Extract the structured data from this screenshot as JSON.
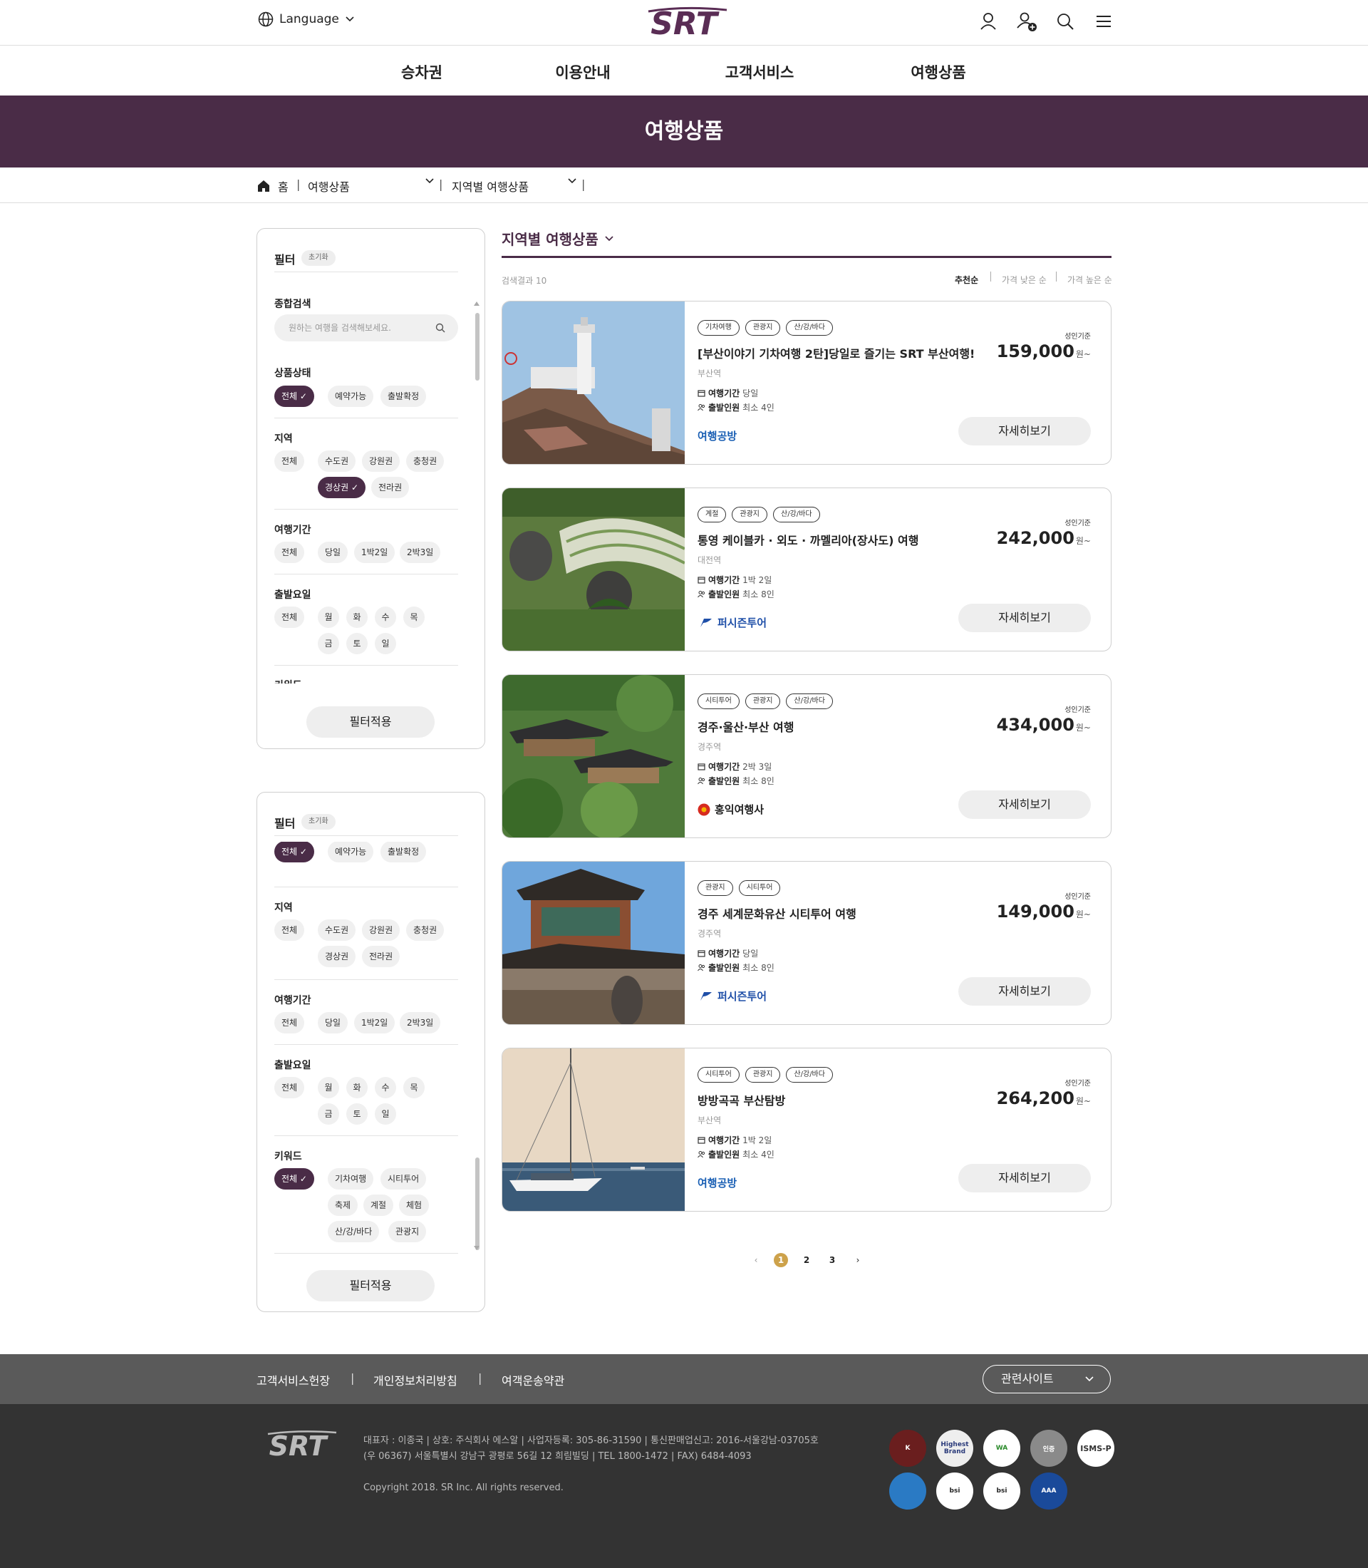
{
  "header": {
    "language_label": "Language",
    "logo_text": "SRT",
    "icons": [
      "user-icon",
      "user-add-icon",
      "search-icon",
      "menu-icon"
    ]
  },
  "gnb": [
    "승차권",
    "이용안내",
    "고객서비스",
    "여행상품"
  ],
  "banner": {
    "title": "여행상품"
  },
  "breadcrumb": {
    "home": "홈",
    "level1": "여행상품",
    "level2": "지역별 여행상품"
  },
  "filter_panels": [
    {
      "title": "필터",
      "reset": "초기화",
      "search": {
        "title": "종합검색",
        "placeholder": "원하는 여행을 검색해보세요."
      },
      "status": {
        "title": "상품상태",
        "options": [
          "전체",
          "예약가능",
          "출발확정"
        ],
        "selected": "전체"
      },
      "region": {
        "title": "지역",
        "options": [
          "전체",
          "수도권",
          "강원권",
          "충청권",
          "경상권",
          "전라권"
        ],
        "selected": "경상권"
      },
      "duration": {
        "title": "여행기간",
        "options": [
          "전체",
          "당일",
          "1박2일",
          "2박3일"
        ]
      },
      "day": {
        "title": "출발요일",
        "options": [
          "전체",
          "월",
          "화",
          "수",
          "목",
          "금",
          "토",
          "일"
        ]
      },
      "keyword_partial": "키워드",
      "apply": "필터적용"
    },
    {
      "title": "필터",
      "reset": "초기화",
      "status": {
        "options": [
          "전체",
          "예약가능",
          "출발확정"
        ],
        "selected": "전체"
      },
      "region": {
        "title": "지역",
        "options": [
          "전체",
          "수도권",
          "강원권",
          "충청권",
          "경상권",
          "전라권"
        ]
      },
      "duration": {
        "title": "여행기간",
        "options": [
          "전체",
          "당일",
          "1박2일",
          "2박3일"
        ]
      },
      "day": {
        "title": "출발요일",
        "options": [
          "전체",
          "월",
          "화",
          "수",
          "목",
          "금",
          "토",
          "일"
        ]
      },
      "keyword": {
        "title": "키워드",
        "options": [
          "전체",
          "기차여행",
          "시티투어",
          "축제",
          "계절",
          "체험",
          "산/강/바다",
          "관광지"
        ],
        "selected": "전체"
      },
      "apply": "필터적용"
    }
  ],
  "listing": {
    "title": "지역별 여행상품",
    "count_text": "검색결과 10",
    "sort": [
      "추천순",
      "가격 낮은 순",
      "가격 높은 순"
    ],
    "sort_selected": "추천순",
    "labels": {
      "duration": "여행기간",
      "people": "출발인원",
      "price_basis": "성인기준",
      "unit": "원~",
      "detail": "자세히보기"
    },
    "products": [
      {
        "tags": [
          "기차여행",
          "관광지",
          "산/강/바다"
        ],
        "title": "[부산이야기 기차여행 2탄]당일로 즐기는 SRT 부산여행!",
        "station": "부산역",
        "duration": "당일",
        "people": "최소 4인",
        "agency": "여행공방",
        "price": "159,000"
      },
      {
        "tags": [
          "계절",
          "관광지",
          "산/강/바다"
        ],
        "title": "통영 케이블카 · 외도 · 까멜리아(장사도) 여행",
        "station": "대전역",
        "duration": "1박 2일",
        "people": "최소 8인",
        "agency": "퍼시즌투어",
        "price": "242,000"
      },
      {
        "tags": [
          "시티투어",
          "관광지",
          "산/강/바다"
        ],
        "title": "경주·울산·부산 여행",
        "station": "경주역",
        "duration": "2박 3일",
        "people": "최소 8인",
        "agency": "홍익여행사",
        "price": "434,000"
      },
      {
        "tags": [
          "관광지",
          "시티투어"
        ],
        "title": "경주 세계문화유산 시티투어 여행",
        "station": "경주역",
        "duration": "당일",
        "people": "최소 8인",
        "agency": "퍼시즌투어",
        "price": "149,000"
      },
      {
        "tags": [
          "시티투어",
          "관광지",
          "산/강/바다"
        ],
        "title": "방방곡곡 부산탐방",
        "station": "부산역",
        "duration": "1박 2일",
        "people": "최소 4인",
        "agency": "여행공방",
        "price": "264,200"
      }
    ]
  },
  "pagination": {
    "prev": "‹",
    "pages": [
      "1",
      "2",
      "3"
    ],
    "current": "1",
    "next": "›"
  },
  "footer": {
    "links": [
      "고객서비스헌장",
      "개인정보처리방침",
      "여객운송약관"
    ],
    "related_label": "관련사이트",
    "info_line1": "대표자 : 이종국 | 상호: 주식회사 에스알 | 사업자등록: 305-86-31590 | 통신판매업신고: 2016-서울강남-03705호",
    "info_line2": "(우 06367) 서울특별시 강남구 광평로 56길 12 희림빌딩 | TEL 1800-1472 | FAX) 6484-4093",
    "copyright": "Copyright 2018. SR Inc. All rights reserved.",
    "badges": [
      "K",
      "Highest Brand",
      "WA",
      "인증",
      "ISMS-P",
      "",
      "bsi",
      "bsi",
      "AAA"
    ]
  },
  "colors": {
    "brand": "#4a2c47",
    "page_active": "#cda24b",
    "footer_top": "#5a5a5a",
    "footer_bottom": "#333333"
  }
}
